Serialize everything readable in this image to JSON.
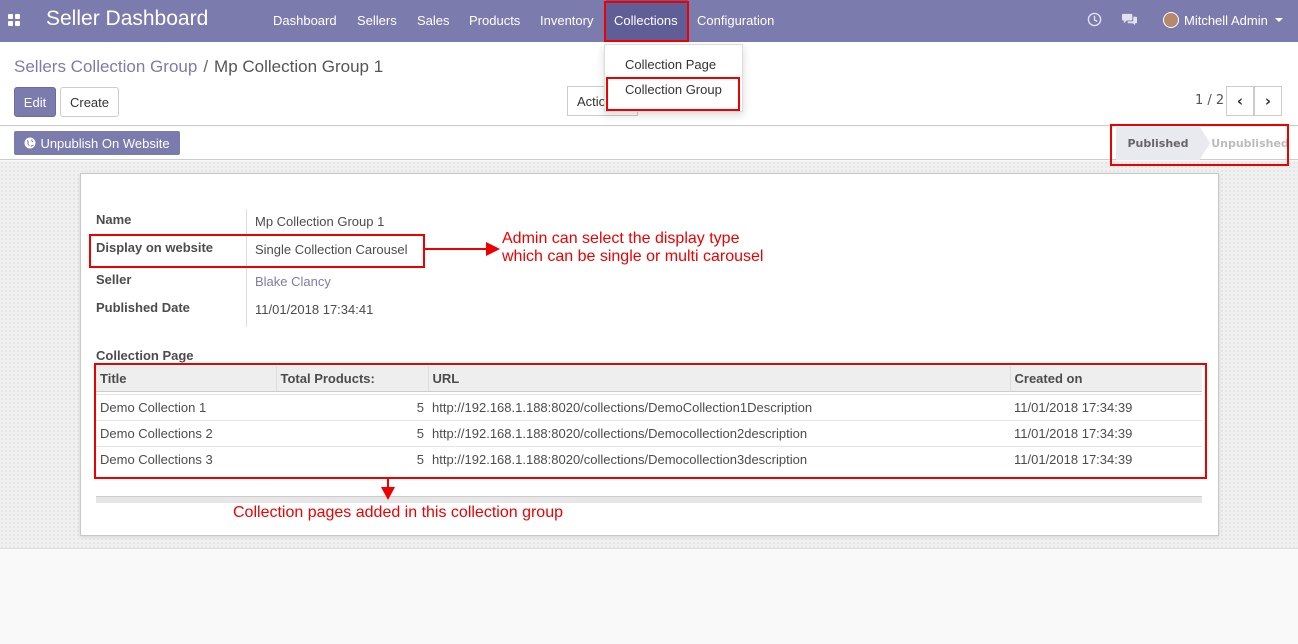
{
  "navbar": {
    "brand": "Seller Dashboard",
    "menu": [
      "Dashboard",
      "Sellers",
      "Sales",
      "Products",
      "Inventory",
      "Collections",
      "Configuration"
    ],
    "user": "Mitchell Admin"
  },
  "dropdown": {
    "items": [
      "Collection Page",
      "Collection Group"
    ]
  },
  "breadcrumb": {
    "parent": "Sellers Collection Group",
    "separator": "/",
    "current": "Mp Collection Group 1"
  },
  "buttons": {
    "edit": "Edit",
    "create": "Create",
    "action": "Action"
  },
  "pager": {
    "value": "1 / 2"
  },
  "statusbar": {
    "publish_button": "Unpublish On Website",
    "stages": [
      "Published",
      "Unpublished"
    ],
    "active_stage": "Published"
  },
  "form": {
    "fields": [
      {
        "label": "Name",
        "value": "Mp Collection Group 1"
      },
      {
        "label": "Display on website",
        "value": "Single Collection Carousel"
      },
      {
        "label": "Seller",
        "value": "Blake Clancy"
      },
      {
        "label": "Published Date",
        "value": "11/01/2018 17:34:41"
      }
    ],
    "section_title": "Collection Page"
  },
  "table": {
    "headers": [
      "Title",
      "Total Products:",
      "URL",
      "Created on"
    ],
    "rows": [
      [
        "Demo Collection 1",
        "5",
        "http://192.168.1.188:8020/collections/DemoCollection1Description",
        "11/01/2018 17:34:39"
      ],
      [
        "Demo Collections 2",
        "5",
        "http://192.168.1.188:8020/collections/Democollection2description",
        "11/01/2018 17:34:39"
      ],
      [
        "Demo Collections 3",
        "5",
        "http://192.168.1.188:8020/collections/Democollection3description",
        "11/01/2018 17:34:39"
      ]
    ]
  },
  "annotations": {
    "display_type_line1": "Admin can select the display type",
    "display_type_line2": "which can be single or multi carousel",
    "collection_pages": "Collection pages added in this collection group"
  },
  "colors": {
    "brand": "#7c7bad",
    "annotation": "#e00000"
  }
}
